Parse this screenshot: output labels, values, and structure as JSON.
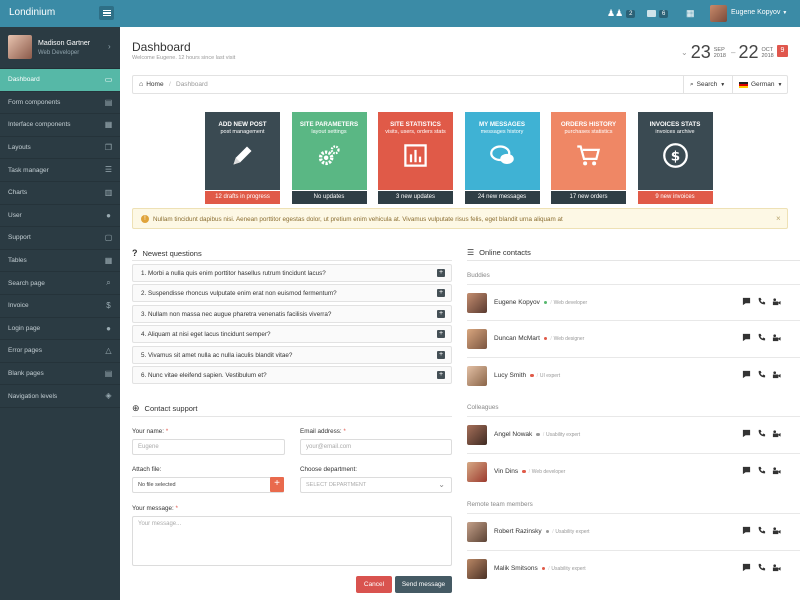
{
  "topbar": {
    "logo": "Londinium",
    "badge1": "2",
    "badge2": "6",
    "user_name": "Eugene Kopyov"
  },
  "sidebar": {
    "profile_name": "Madison Gartner",
    "profile_role": "Web Developer",
    "items": [
      {
        "label": "Dashboard",
        "icon": "monitor-icon",
        "glyph": "▭"
      },
      {
        "label": "Form components",
        "icon": "form-icon",
        "glyph": "▤"
      },
      {
        "label": "Interface components",
        "icon": "grid-icon",
        "glyph": "▦"
      },
      {
        "label": "Layouts",
        "icon": "layouts-icon",
        "glyph": "❐"
      },
      {
        "label": "Task manager",
        "icon": "list-icon",
        "glyph": "☰"
      },
      {
        "label": "Charts",
        "icon": "chart-icon",
        "glyph": "▥"
      },
      {
        "label": "User",
        "icon": "user-icon",
        "glyph": "●"
      },
      {
        "label": "Support",
        "icon": "chat-icon",
        "glyph": "▢"
      },
      {
        "label": "Tables",
        "icon": "table-icon",
        "glyph": "▦"
      },
      {
        "label": "Search page",
        "icon": "search-icon",
        "glyph": "⌕"
      },
      {
        "label": "Invoice",
        "icon": "dollar-icon",
        "glyph": "$"
      },
      {
        "label": "Login page",
        "icon": "user-settings-icon",
        "glyph": "●"
      },
      {
        "label": "Error pages",
        "icon": "warning-icon",
        "glyph": "△"
      },
      {
        "label": "Blank pages",
        "icon": "blank-page-icon",
        "glyph": "▤"
      },
      {
        "label": "Navigation levels",
        "icon": "layers-icon",
        "glyph": "◈"
      }
    ]
  },
  "header": {
    "title": "Dashboard",
    "subtitle": "Welcome Eugene. 12 hours since last visit",
    "date1_day": "23",
    "date1_mon": "SEP",
    "date1_year": "2018",
    "date2_day": "22",
    "date2_mon": "OCT",
    "date2_year": "2018",
    "date_badge": "9"
  },
  "breadcrumb": {
    "home": "Home",
    "current": "Dashboard",
    "search": "Search",
    "language": "German"
  },
  "tiles": [
    {
      "title": "ADD NEW POST",
      "sub": "post management",
      "footer": "12 drafts in progress",
      "color": "#3a4a52",
      "foot_color": "#e05a48",
      "icon": "pencil-icon"
    },
    {
      "title": "SITE PARAMETERS",
      "sub": "layout settings",
      "footer": "No updates",
      "color": "#5ab784",
      "foot_color": "#2f3e45",
      "icon": "gears-icon"
    },
    {
      "title": "SITE STATISTICS",
      "sub": "visits, users, orders stats",
      "footer": "3 new updates",
      "color": "#e05a48",
      "foot_color": "#2f3e45",
      "icon": "statistics-icon"
    },
    {
      "title": "MY MESSAGES",
      "sub": "messages history",
      "footer": "24 new messages",
      "color": "#3fb2d4",
      "foot_color": "#2f3e45",
      "icon": "messages-icon"
    },
    {
      "title": "ORDERS HISTORY",
      "sub": "purchases statistics",
      "footer": "17 new orders",
      "color": "#ef8765",
      "foot_color": "#2f3e45",
      "icon": "cart-icon"
    },
    {
      "title": "INVOICES STATS",
      "sub": "invoices archive",
      "footer": "9 new invoices",
      "color": "#3a4a52",
      "foot_color": "#e05a48",
      "icon": "dollar-coin-icon"
    }
  ],
  "alert": {
    "text": "Nullam tincidunt dapibus nisi. Aenean porttitor egestas dolor, ut pretium enim vehicula at. Vivamus vulputate risus felis, eget blandit urna aliquam at"
  },
  "questions": {
    "title": "Newest questions",
    "items": [
      "1. Morbi a nulla quis enim porttitor hasellus rutrum tincidunt lacus?",
      "2. Suspendisse rhoncus vulputate enim erat non euismod fermentum?",
      "3. Nullam non massa nec augue pharetra venenatis facilisis viverra?",
      "4. Aliquam at nisi eget lacus tincidunt semper?",
      "5. Vivamus sit amet nulla ac nulla iaculis blandit vitae?",
      "6. Nunc vitae eleifend sapien. Vestibulum et?"
    ]
  },
  "support": {
    "title": "Contact support",
    "name_label": "Your name:",
    "name_value": "Eugene",
    "email_label": "Email address:",
    "email_placeholder": "your@email.com",
    "file_label": "Attach file:",
    "file_value": "No file selected",
    "dept_label": "Choose department:",
    "dept_value": "SELECT DEPARTMENT",
    "message_label": "Your message:",
    "message_placeholder": "Your message...",
    "cancel": "Cancel",
    "send": "Send message"
  },
  "contacts": {
    "title": "Online contacts",
    "groups": {
      "buddies": "Buddies",
      "colleagues": "Colleagues",
      "remote": "Remote team members"
    },
    "people": [
      {
        "name": "Eugene Kopyov",
        "role": "Web developer",
        "status": "#56b86e",
        "avatar_a": "#c48e70",
        "avatar_b": "#5a3a30"
      },
      {
        "name": "Duncan McMart",
        "role": "Web designer",
        "status": "#e05a48",
        "avatar_a": "#d9a77f",
        "avatar_b": "#7b5540"
      },
      {
        "name": "Lucy Smith",
        "role": "UI expert",
        "status": "#e05a48",
        "avatar_a": "#e3c0a5",
        "avatar_b": "#8a6548"
      },
      {
        "name": "Angel Nowak",
        "role": "Usability expert",
        "status": "#999999",
        "avatar_a": "#a6705a",
        "avatar_b": "#3f2a22"
      },
      {
        "name": "Vin Dins",
        "role": "Web developer",
        "status": "#e05a48",
        "avatar_a": "#d6a985",
        "avatar_b": "#9c3a2e"
      },
      {
        "name": "Robert Razinsky",
        "role": "Usability expert",
        "status": "#999999",
        "avatar_a": "#c4a089",
        "avatar_b": "#5b4335"
      },
      {
        "name": "Malik Smitsons",
        "role": "Usability expert",
        "status": "#e05a48",
        "avatar_a": "#b98765",
        "avatar_b": "#4a3125"
      }
    ]
  }
}
